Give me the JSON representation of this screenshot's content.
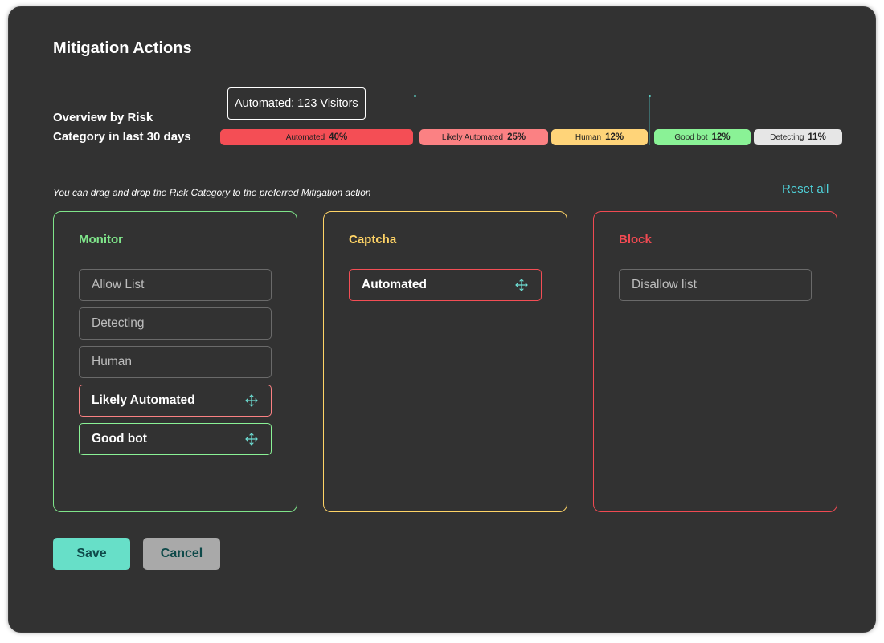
{
  "dialog": {
    "title": "Mitigation Actions",
    "overview_label": "Overview by Risk Category in last 30 days",
    "tooltip": "Automated: 123 Visitors",
    "hint": "You can drag and drop the Risk Category to the preferred Mitigation action",
    "reset_all": "Reset all"
  },
  "risk_bar": [
    {
      "label": "Automated",
      "percent": "40%",
      "color": "#f44e55"
    },
    {
      "label": "Likely Automated",
      "percent": "25%",
      "color": "#fb8183"
    },
    {
      "label": "Human",
      "percent": "12%",
      "color": "#ffd479"
    },
    {
      "label": "Good bot",
      "percent": "12%",
      "color": "#8af296"
    },
    {
      "label": "Detecting",
      "percent": "11%",
      "color": "#e6e6e6"
    }
  ],
  "panels": {
    "monitor": {
      "title": "Monitor",
      "color": "#7fe58a",
      "items": [
        "Allow List",
        "Detecting",
        "Human",
        "Likely Automated",
        "Good bot"
      ]
    },
    "captcha": {
      "title": "Captcha",
      "color": "#ffd466",
      "items": [
        "Automated"
      ]
    },
    "block": {
      "title": "Block",
      "color": "#f04a52",
      "items": [
        "Disallow list"
      ]
    }
  },
  "icons": {
    "drag": "move-arrows-icon"
  },
  "buttons": {
    "save": "Save",
    "cancel": "Cancel"
  },
  "colors": {
    "accent": "#67dfc8",
    "cancel_bg": "#a9a9a9",
    "link": "#4fd1d9",
    "background": "#323232"
  }
}
